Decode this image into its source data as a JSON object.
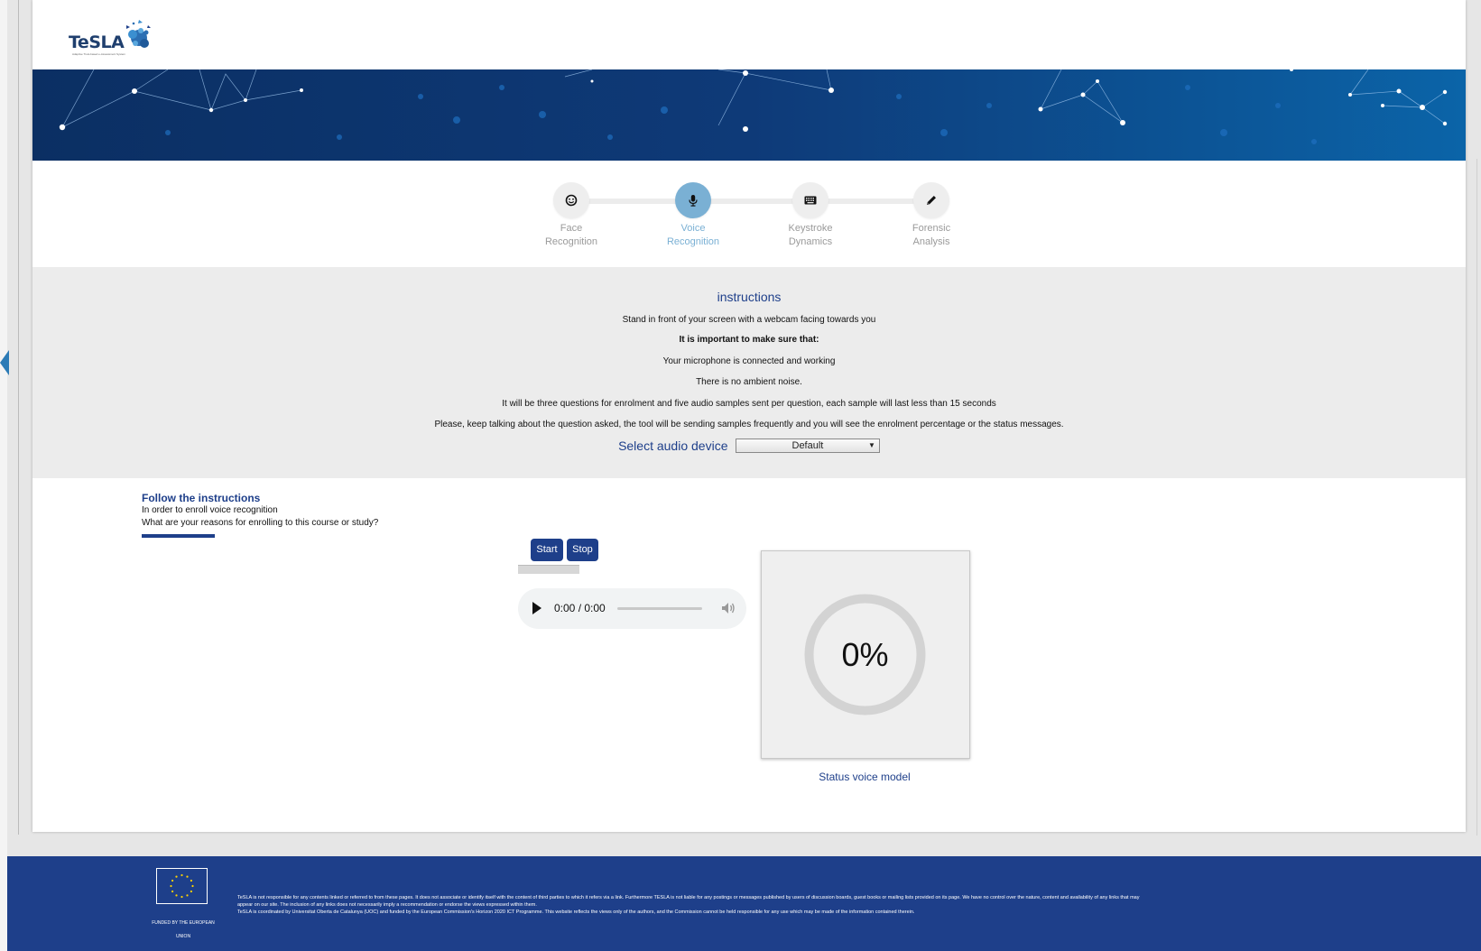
{
  "app": {
    "logo_text": "TeSLA",
    "logo_tagline": "Adaptive Trust-based e-Assessment System"
  },
  "steps": [
    {
      "label": "Face\nRecognition",
      "label_l1": "Face",
      "label_l2": "Recognition",
      "icon": "smiley-icon",
      "active": false
    },
    {
      "label_l1": "Voice",
      "label_l2": "Recognition",
      "icon": "microphone-icon",
      "active": true
    },
    {
      "label_l1": "Keystroke",
      "label_l2": "Dynamics",
      "icon": "keyboard-icon",
      "active": false
    },
    {
      "label_l1": "Forensic",
      "label_l2": "Analysis",
      "icon": "pencil-icon",
      "active": false
    }
  ],
  "instructions": {
    "title": "instructions",
    "line1": "Stand in front of your screen with a webcam facing towards you",
    "line2": "It is important to make sure that:",
    "line3": "Your microphone is connected and working",
    "line4": "There is no ambient noise.",
    "line5": "It will be three questions for enrolment and five audio samples sent per question, each sample will last less than 15 seconds",
    "line6": "Please, keep talking about the question asked, the tool will be sending samples frequently and you will see the enrolment percentage or the status messages.",
    "device_label": "Select audio device",
    "device_value": "Default"
  },
  "follow": {
    "title": "Follow the instructions",
    "line1": "In order to enroll voice recognition",
    "line2": "What are your reasons for enrolling to this course or study?"
  },
  "controls": {
    "start_label": "Start",
    "stop_label": "Stop"
  },
  "audio": {
    "time": "0:00 / 0:00",
    "playback_progress": 0
  },
  "status": {
    "percent_text": "0%",
    "percent_value": 0,
    "label": "Status voice model"
  },
  "footer": {
    "eu_caption_l1": "FUNDED BY THE EUROPEAN",
    "eu_caption_l2": "UNION",
    "disclaimer_l1": "TeSLA is not responsible for any contents linked or referred to from these pages. It does not associate or identify itself with the content of third parties to which it refers via a link. Furthermore TESLA is not liable for any postings or messages published by users of discussion boards, guest books or mailing lists provided on its page. We have no control over the nature, content and availability of any links that may",
    "disclaimer_l2": "appear on our site. The inclusion of any links does not necessarily imply a recommendation or endorse the views expressed within them.",
    "disclaimer_l3": "TeSLA is coordinated by Universitat Oberta de Catalunya (UOC) and funded by the European Commission's Horizon 2020 ICT Programme. This website reflects the views only of the authors, and the Commission cannot be held responsible for any use which may be made of the information contained therein."
  },
  "colors": {
    "brand_blue": "#1e3f8a",
    "active_step": "#7ab0d4",
    "instructions_bg": "#ececec"
  }
}
